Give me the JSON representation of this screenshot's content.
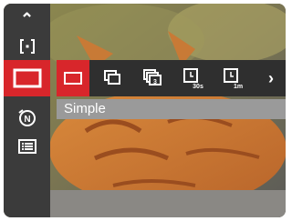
{
  "menu": {
    "selected_label": "Simple"
  },
  "sidebar": {
    "items": [
      {
        "name": "up-arrow-icon"
      },
      {
        "name": "focus-frame-icon"
      },
      {
        "name": "drive-mode-icon",
        "selected": true
      },
      {
        "name": "n-mode-icon"
      },
      {
        "name": "menu-icon"
      }
    ]
  },
  "drive_options": [
    {
      "name": "single-frame-icon",
      "selected": true
    },
    {
      "name": "continuous-shot-icon"
    },
    {
      "name": "burst-3-icon",
      "text": "3"
    },
    {
      "name": "self-timer-30s-icon",
      "text": "30s"
    },
    {
      "name": "self-timer-1m-icon",
      "text": "1m"
    }
  ],
  "colors": {
    "accent": "#d8262b",
    "sidebar": "#3b3b3b",
    "strip": "#2f2f2f",
    "label_bar": "#9a9a9a"
  }
}
